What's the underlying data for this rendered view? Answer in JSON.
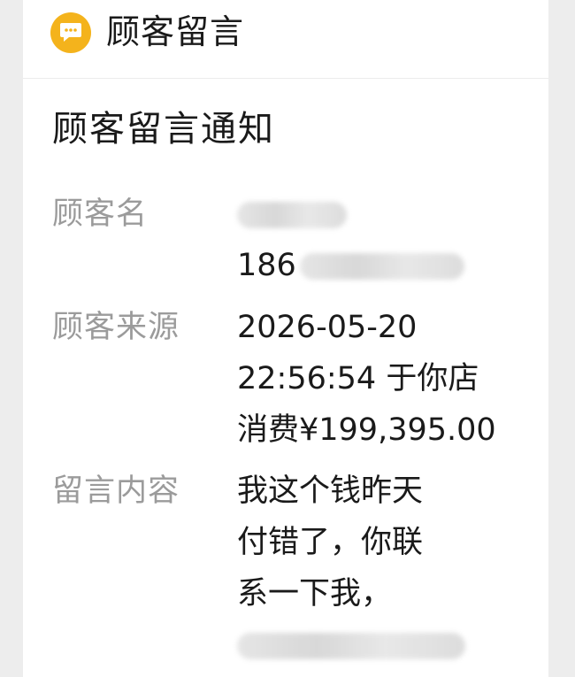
{
  "header": {
    "title": "顾客留言",
    "icon": "chat-bubble-icon",
    "icon_color": "#f4b31c"
  },
  "notice": {
    "title": "顾客留言通知"
  },
  "fields": {
    "customer_name": {
      "label": "顾客名",
      "phone_prefix": "186"
    },
    "customer_source": {
      "label": "顾客来源",
      "lines": [
        "2026-05-20",
        "22:56:54 于你店",
        "消费¥199,395.00"
      ]
    },
    "message_content": {
      "label": "留言内容",
      "lines": [
        "我这个钱昨天",
        "付错了，你联",
        "系一下我，"
      ]
    }
  }
}
